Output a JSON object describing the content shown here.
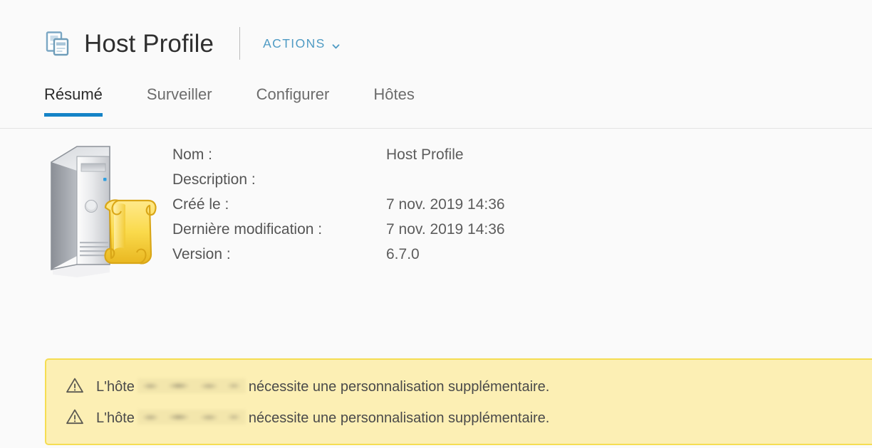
{
  "header": {
    "icon": "host-profile-icon",
    "title": "Host Profile",
    "actions_label": "ACTIONS",
    "actions_chevron": "chevron-down-icon"
  },
  "tabs": [
    {
      "label": "Résumé",
      "active": true
    },
    {
      "label": "Surveiller",
      "active": false
    },
    {
      "label": "Configurer",
      "active": false
    },
    {
      "label": "Hôtes",
      "active": false
    }
  ],
  "summary": {
    "art_icon": "server-with-scroll-icon",
    "fields": [
      {
        "label": "Nom :",
        "value": "Host Profile"
      },
      {
        "label": "Description :",
        "value": ""
      },
      {
        "label": "Créé le :",
        "value": "7 nov. 2019 14:36"
      },
      {
        "label": "Dernière modification :",
        "value": "7 nov. 2019 14:36"
      },
      {
        "label": "Version :",
        "value": "6.7.0"
      }
    ]
  },
  "banner": {
    "icon": "warning-triangle-icon",
    "messages": [
      {
        "prefix": "L'hôte",
        "redacted": true,
        "suffix": "nécessite une personnalisation supplémentaire."
      },
      {
        "prefix": "L'hôte",
        "redacted": true,
        "suffix": "nécessite une personnalisation supplémentaire."
      }
    ]
  },
  "colors": {
    "page_background": "#fafafa",
    "accent_blue": "#1583c7",
    "action_link": "#4f9bc4",
    "title_text": "#2f2f2f",
    "label_text": "#555555",
    "banner_background": "#fcefb4",
    "banner_border": "#f5dd52",
    "divider": "#e4e4e4"
  }
}
